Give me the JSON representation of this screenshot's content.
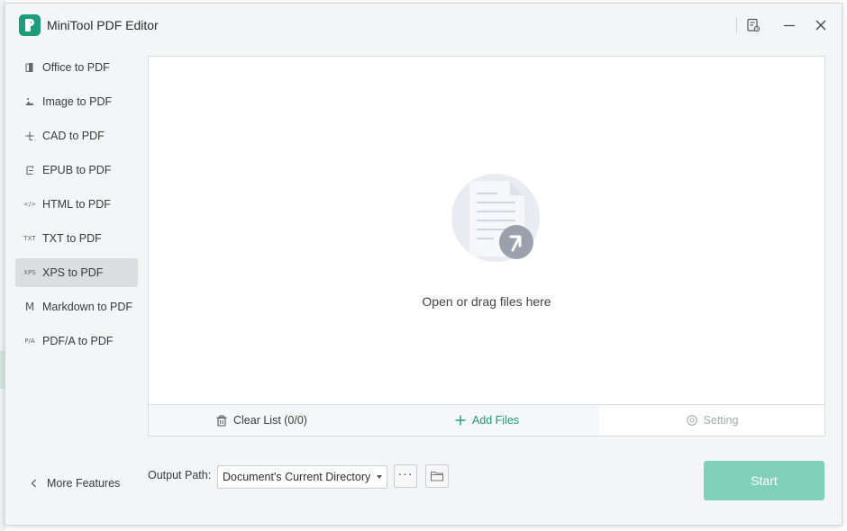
{
  "window": {
    "title": "MiniTool PDF Editor"
  },
  "sidebar": {
    "items": [
      {
        "label": "Office to PDF",
        "icon": "office-icon",
        "active": false
      },
      {
        "label": "Image to PDF",
        "icon": "image-icon",
        "active": false
      },
      {
        "label": "CAD to PDF",
        "icon": "cad-icon",
        "active": false
      },
      {
        "label": "EPUB to PDF",
        "icon": "epub-icon",
        "active": false
      },
      {
        "label": "HTML to PDF",
        "icon": "html-icon",
        "active": false,
        "glyph": "</>"
      },
      {
        "label": "TXT to PDF",
        "icon": "txt-icon",
        "active": false,
        "glyph": "TXT"
      },
      {
        "label": "XPS to PDF",
        "icon": "xps-icon",
        "active": true,
        "glyph": "XPS"
      },
      {
        "label": "Markdown to PDF",
        "icon": "markdown-icon",
        "active": false,
        "glyph": "M"
      },
      {
        "label": "PDF/A to PDF",
        "icon": "pdfa-icon",
        "active": false,
        "glyph": "P/A"
      }
    ],
    "more_features": "More Features"
  },
  "drop_zone": {
    "text": "Open or drag files here"
  },
  "panel_bar": {
    "clear_list": "Clear List (0/0)",
    "add_files": "Add Files",
    "setting": "Setting"
  },
  "output": {
    "label": "Output Path:",
    "selected": "Document's Current Directory",
    "browse_glyph": "···"
  },
  "start": {
    "label": "Start"
  },
  "colors": {
    "accent": "#1e9b78",
    "start_disabled": "#7fd0b9",
    "active_item": "#dcdde0",
    "window_bg": "#f4f5f7"
  }
}
